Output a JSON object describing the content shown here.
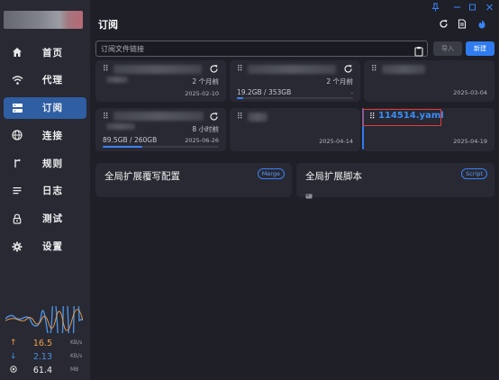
{
  "sidebar": {
    "items": [
      {
        "label": "首页",
        "icon": "home-icon"
      },
      {
        "label": "代理",
        "icon": "wifi-icon"
      },
      {
        "label": "订阅",
        "icon": "subscription-icon",
        "active": true
      },
      {
        "label": "连接",
        "icon": "globe-icon"
      },
      {
        "label": "规则",
        "icon": "fork-icon"
      },
      {
        "label": "日志",
        "icon": "log-icon"
      },
      {
        "label": "测试",
        "icon": "lock-icon"
      },
      {
        "label": "设置",
        "icon": "gear-icon"
      }
    ],
    "traffic": {
      "upload": {
        "value": "16.5",
        "unit": "KB/s",
        "arrow": "↑"
      },
      "download": {
        "value": "2.13",
        "unit": "KB/s",
        "arrow": "↓"
      },
      "memory": {
        "value": "61.4",
        "unit": "MB"
      }
    }
  },
  "header": {
    "title": "订阅"
  },
  "import_bar": {
    "placeholder": "订阅文件链接",
    "import_label": "导入",
    "new_label": "新建"
  },
  "profiles": [
    {
      "updated": "2 个月前",
      "date": "2025-02-10"
    },
    {
      "updated": "2 个月前",
      "usage": "19.2GB / 353GB",
      "expire": "-",
      "progress": 0.054
    },
    {
      "date": "2025-03-04"
    },
    {
      "updated": "8 小时前",
      "usage": "89.5GB / 260GB",
      "date": "2025-06-26",
      "progress": 0.344
    },
    {
      "date": "2025-04-14"
    },
    {
      "name": "114514.yaml",
      "date": "2025-04-19",
      "selected": true
    }
  ],
  "extensions": {
    "merge": {
      "title": "全局扩展覆写配置",
      "badge": "Merge"
    },
    "script": {
      "title": "全局扩展脚本",
      "badge": "Script"
    }
  },
  "colors": {
    "accent": "#2f7bef",
    "highlight_box": "#e23a3a",
    "upload": "#f5a24b",
    "download": "#4a90e2"
  }
}
